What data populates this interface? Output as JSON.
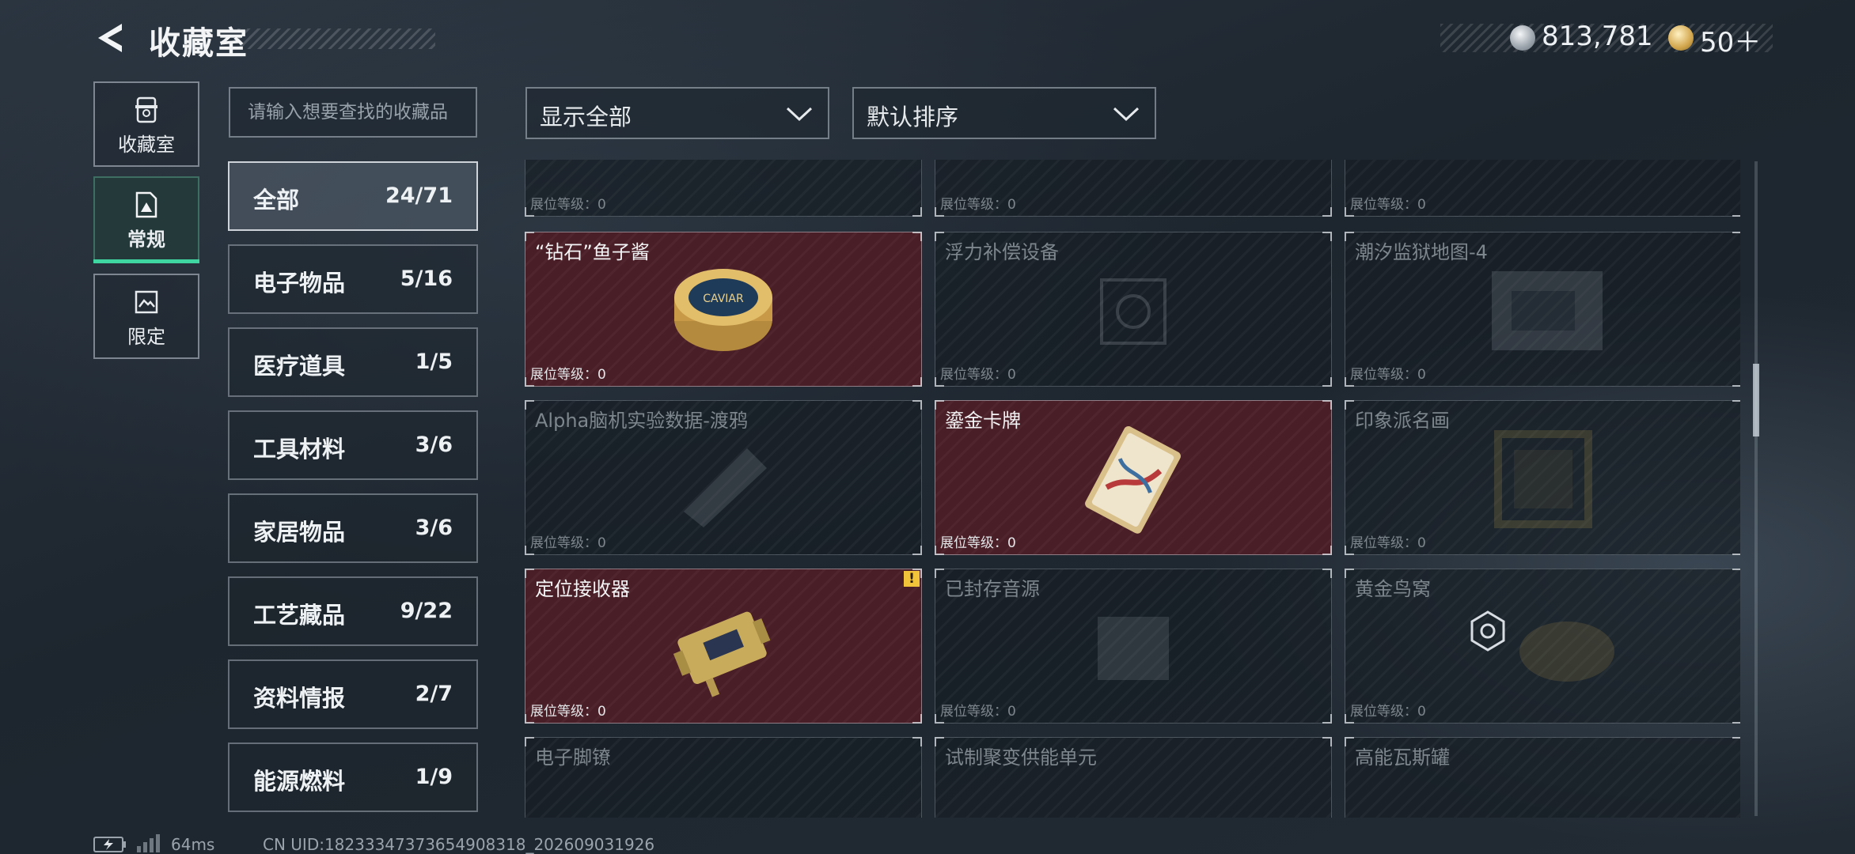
{
  "header": {
    "title": "收藏室",
    "currencies": [
      {
        "icon": "silver-coin-icon",
        "value": "813,781"
      },
      {
        "icon": "gold-coin-icon",
        "value": "50＋"
      }
    ]
  },
  "side_tabs": [
    {
      "label": "收藏室",
      "icon": "collection-room-icon",
      "active": false
    },
    {
      "label": "常规",
      "icon": "regular-icon",
      "active": true
    },
    {
      "label": "限定",
      "icon": "limited-icon",
      "active": false
    }
  ],
  "search": {
    "placeholder": "请输入想要查找的收藏品"
  },
  "categories": [
    {
      "name": "全部",
      "count": "24/71",
      "active": true
    },
    {
      "name": "电子物品",
      "count": "5/16"
    },
    {
      "name": "医疗道具",
      "count": "1/5"
    },
    {
      "name": "工具材料",
      "count": "3/6"
    },
    {
      "name": "家居物品",
      "count": "3/6"
    },
    {
      "name": "工艺藏品",
      "count": "9/22"
    },
    {
      "name": "资料情报",
      "count": "2/7"
    },
    {
      "name": "能源燃料",
      "count": "1/9"
    }
  ],
  "filters": {
    "display": {
      "value": "显示全部",
      "icon": "chevron-down-icon"
    },
    "sort": {
      "value": "默认排序",
      "icon": "chevron-down-icon"
    }
  },
  "items": [
    {
      "name": "",
      "level": "展位等级：0",
      "owned": false
    },
    {
      "name": "",
      "level": "展位等级：0",
      "owned": false
    },
    {
      "name": "",
      "level": "展位等级：0",
      "owned": false
    },
    {
      "name": "“钻石”鱼子酱",
      "level": "展位等级：0",
      "owned": true,
      "icon": "caviar-tin-icon",
      "art_text": "CAVIAR"
    },
    {
      "name": "浮力补偿设备",
      "level": "展位等级：0",
      "owned": false,
      "icon": "buoyancy-device-icon"
    },
    {
      "name": "潮汐监狱地图-4",
      "level": "展位等级：0",
      "owned": false,
      "icon": "map-icon"
    },
    {
      "name": "Alpha脑机实验数据-渡鸦",
      "level": "展位等级：0",
      "owned": false,
      "icon": "data-drive-icon"
    },
    {
      "name": "鎏金卡牌",
      "level": "展位等级：0",
      "owned": true,
      "icon": "gilded-card-icon"
    },
    {
      "name": "印象派名画",
      "level": "展位等级：0",
      "owned": false,
      "icon": "painting-icon"
    },
    {
      "name": "定位接收器",
      "level": "展位等级：0",
      "owned": true,
      "icon": "locator-receiver-icon",
      "alert": "!"
    },
    {
      "name": "已封存音源",
      "level": "展位等级：0",
      "owned": false,
      "icon": "sealed-audio-icon"
    },
    {
      "name": "黄金鸟窝",
      "level": "展位等级：0",
      "owned": false,
      "icon": "golden-nest-icon"
    },
    {
      "name": "电子脚镣",
      "level": "",
      "owned": false,
      "icon": "ankle-monitor-icon"
    },
    {
      "name": "试制聚变供能单元",
      "level": "",
      "owned": false,
      "icon": "fusion-unit-icon"
    },
    {
      "name": "高能瓦斯罐",
      "level": "",
      "owned": false,
      "icon": "gas-tank-icon"
    }
  ],
  "footer": {
    "latency": "64ms",
    "uid": "CN UID:1823334737365490831​8_202609031926"
  }
}
